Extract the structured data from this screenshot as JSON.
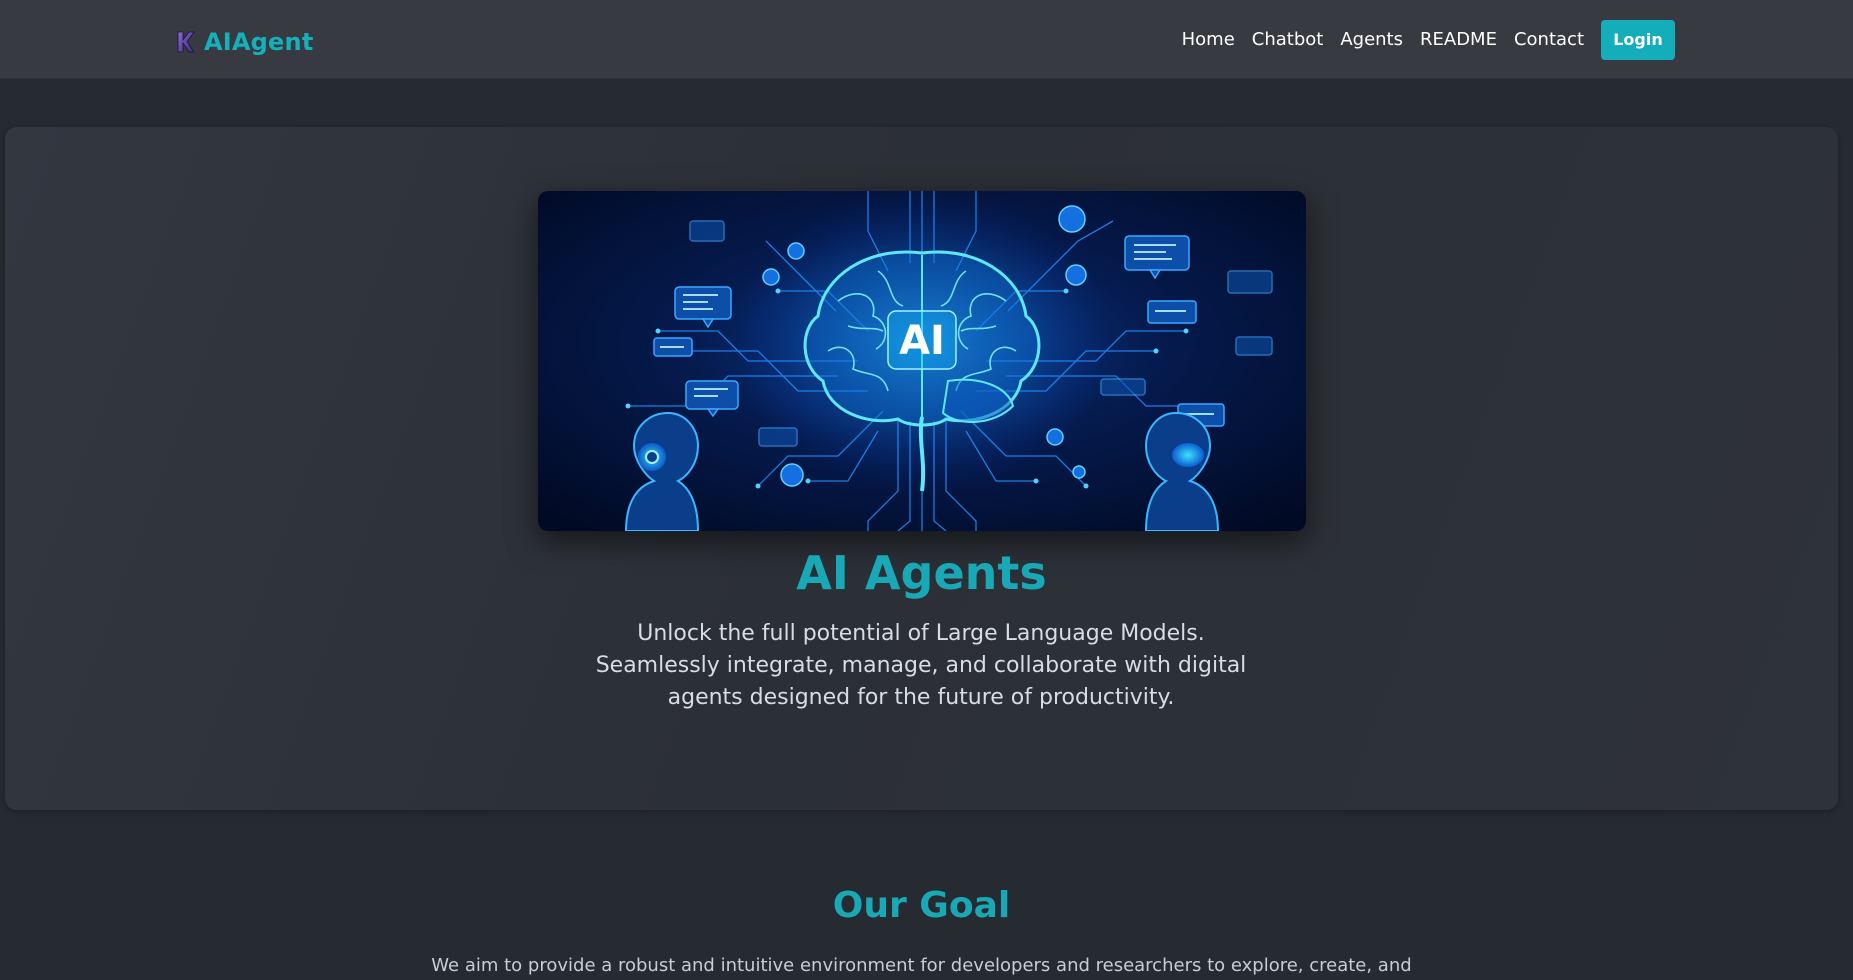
{
  "header": {
    "brand_name": "AIAgent",
    "brand_logo_letter": "K",
    "nav_links": [
      "Home",
      "Chatbot",
      "Agents",
      "README",
      "Contact"
    ],
    "login_label": "Login"
  },
  "hero": {
    "image_label": "AI",
    "title": "AI Agents",
    "description": "Unlock the full potential of Large Language Models. Seamlessly integrate, manage, and collaborate with digital agents designed for the future of productivity."
  },
  "goal": {
    "title": "Our Goal",
    "description": "We aim to provide a robust and intuitive environment for developers and researchers to explore, create, and"
  },
  "colors": {
    "accent": "#14b1bd",
    "background": "#262a31",
    "navbar": "#373a41",
    "hero_card": "#30343b"
  }
}
